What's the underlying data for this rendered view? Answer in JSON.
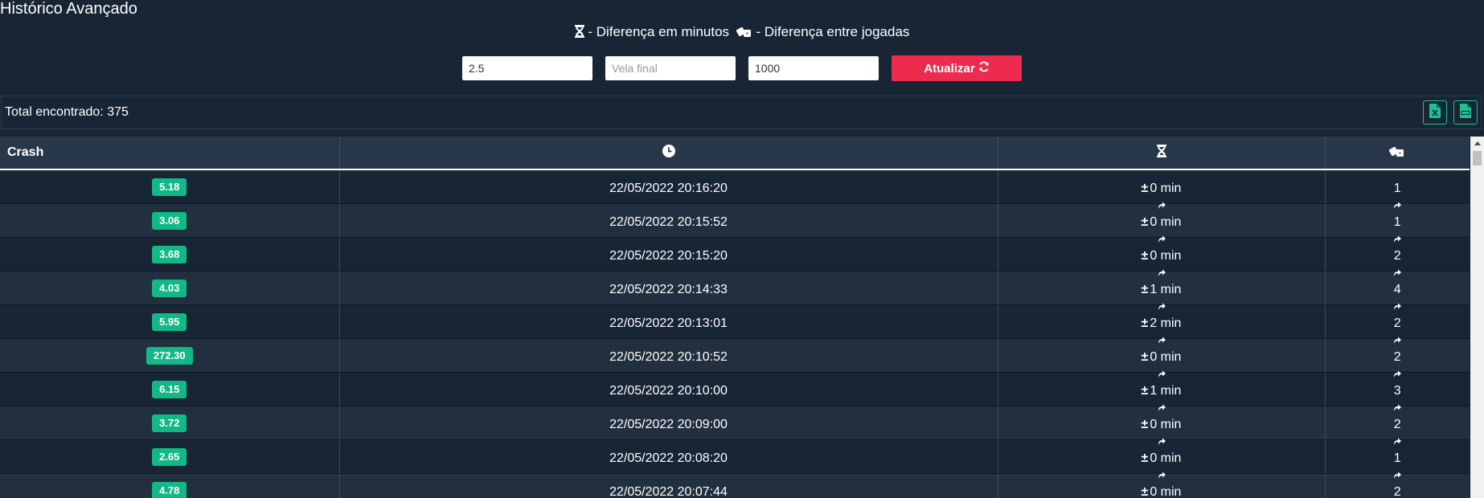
{
  "page": {
    "title": "Histórico Avançado",
    "legend_minutes": "- Diferença em minutos",
    "legend_plays": "- Diferença entre jogadas"
  },
  "controls": {
    "multiplier_value": "2.5",
    "final_candle_placeholder": "Vela final",
    "limit_value": "1000",
    "update_label": "Atualizar"
  },
  "summary": {
    "total_text": "Total encontrado: 375"
  },
  "table": {
    "headers": {
      "crash": "Crash"
    },
    "rows": [
      {
        "crash": "5.18",
        "time": "22/05/2022 20:16:20",
        "minutes": "0 min",
        "plays": "1"
      },
      {
        "crash": "3.06",
        "time": "22/05/2022 20:15:52",
        "minutes": "0 min",
        "plays": "1"
      },
      {
        "crash": "3.68",
        "time": "22/05/2022 20:15:20",
        "minutes": "0 min",
        "plays": "2"
      },
      {
        "crash": "4.03",
        "time": "22/05/2022 20:14:33",
        "minutes": "1 min",
        "plays": "4"
      },
      {
        "crash": "5.95",
        "time": "22/05/2022 20:13:01",
        "minutes": "2 min",
        "plays": "2"
      },
      {
        "crash": "272.30",
        "time": "22/05/2022 20:10:52",
        "minutes": "0 min",
        "plays": "2"
      },
      {
        "crash": "6.15",
        "time": "22/05/2022 20:10:00",
        "minutes": "1 min",
        "plays": "3"
      },
      {
        "crash": "3.72",
        "time": "22/05/2022 20:09:00",
        "minutes": "0 min",
        "plays": "2"
      },
      {
        "crash": "2.65",
        "time": "22/05/2022 20:08:20",
        "minutes": "0 min",
        "plays": "1"
      },
      {
        "crash": "4.78",
        "time": "22/05/2022 20:07:44",
        "minutes": "0 min",
        "plays": "2"
      }
    ]
  },
  "icons": {
    "hourglass": "hourglass-icon",
    "dice": "dice-icon",
    "clock": "clock-icon",
    "refresh": "refresh-icon",
    "excel": "excel-file-icon",
    "csv": "csv-file-icon",
    "arrow": "arrow-turn-up-icon"
  },
  "colors": {
    "background": "#172535",
    "badge": "#12b886",
    "update_button": "#ed2b4f",
    "export_border": "#1fbf8f"
  }
}
